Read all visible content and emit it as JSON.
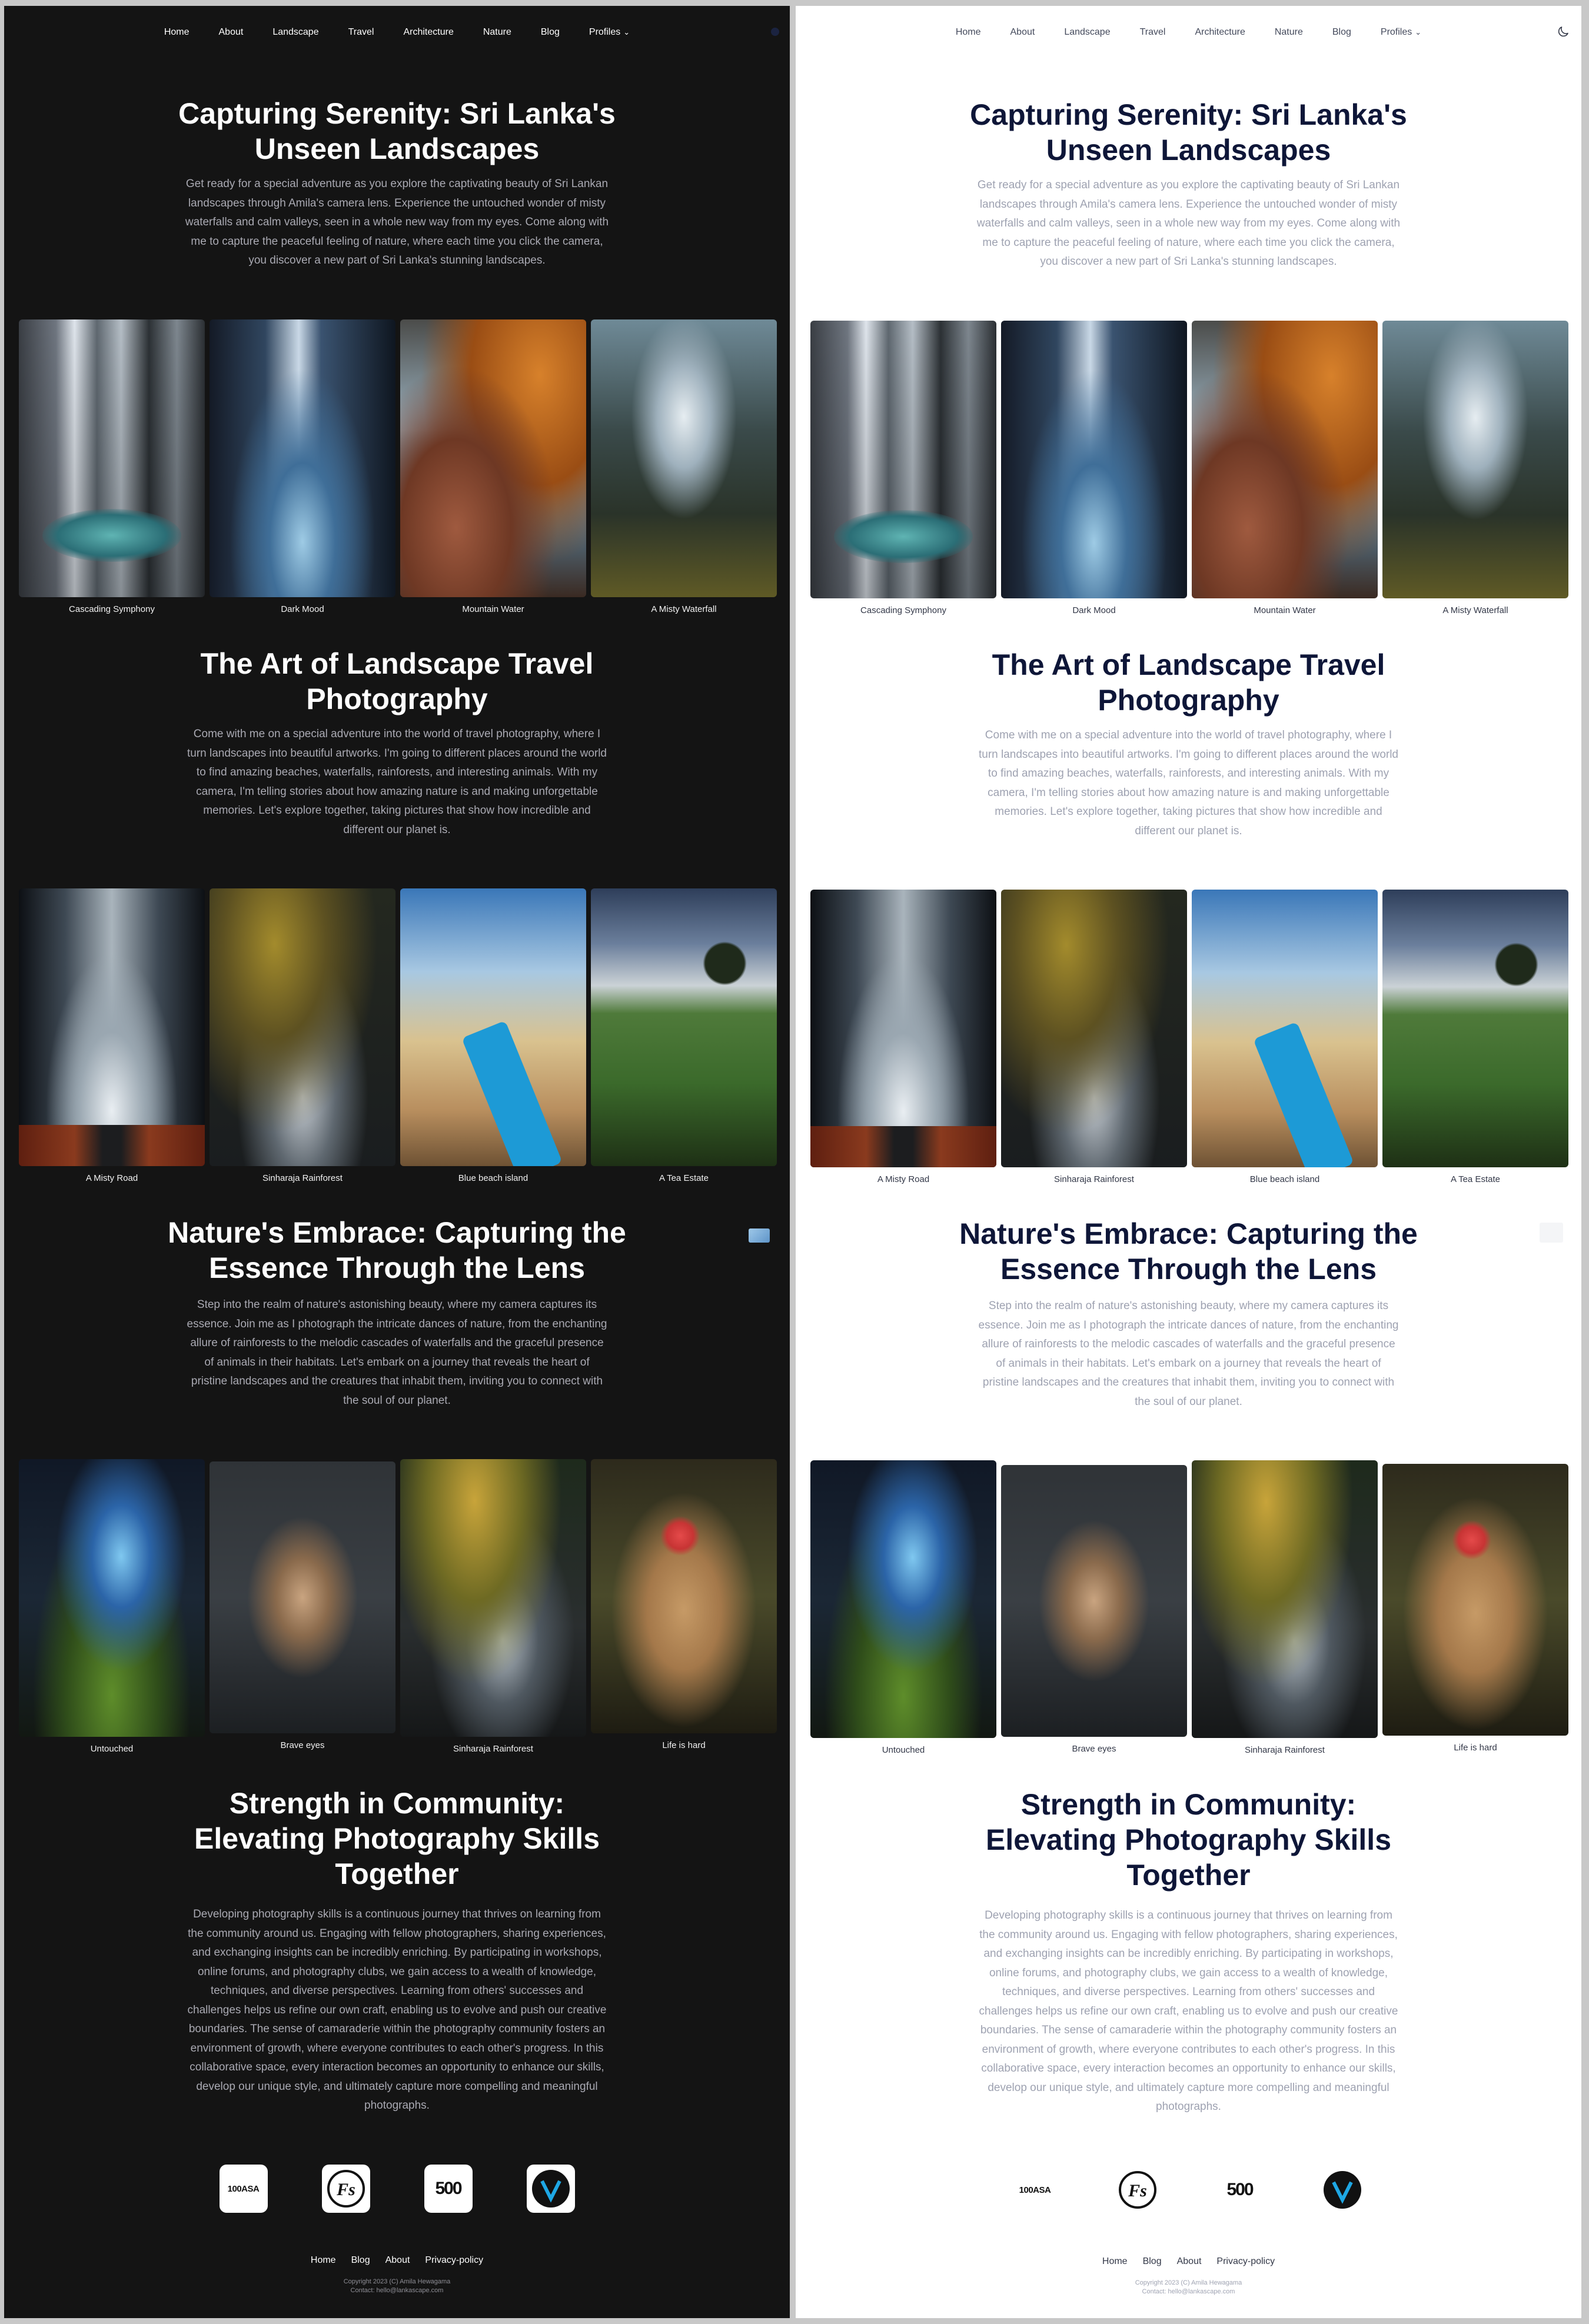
{
  "nav": {
    "items": [
      "Home",
      "About",
      "Landscape",
      "Travel",
      "Architecture",
      "Nature",
      "Blog",
      "Profiles"
    ]
  },
  "sections": [
    {
      "title": "Capturing Serenity: Sri Lanka's Unseen Landscapes",
      "text": "Get ready for a special adventure as you explore the captivating beauty of Sri Lankan landscapes through Amila's camera lens. Experience the untouched wonder of misty waterfalls and calm valleys, seen in a whole new way from my eyes. Come along with me to capture the peaceful feeling of nature, where each time you click the camera, you discover a new part of Sri Lanka's stunning landscapes.",
      "photos": [
        "Cascading Symphony",
        "Dark Mood",
        "Mountain Water",
        "A Misty Waterfall"
      ]
    },
    {
      "title": "The Art of Landscape Travel Photography",
      "text": "Come with me on a special adventure into the world of travel photography, where I turn landscapes into beautiful artworks. I'm going to different places around the world to find amazing beaches, waterfalls, rainforests, and interesting animals. With my camera, I'm telling stories about how amazing nature is and making unforgettable memories. Let's explore together, taking pictures that show how incredible and different our planet is.",
      "photos": [
        "A Misty Road",
        "Sinharaja Rainforest",
        "Blue beach island",
        "A Tea Estate"
      ]
    },
    {
      "title": "Nature's Embrace: Capturing the Essence Through the Lens",
      "text": "Step into the realm of nature's astonishing beauty, where my camera captures its essence. Join me as I photograph the intricate dances of nature, from the enchanting allure of rainforests to the melodic cascades of waterfalls and the graceful presence of animals in their habitats. Let's embark on a journey that reveals the heart of pristine landscapes and the creatures that inhabit them, inviting you to connect with the soul of our planet.",
      "photos": [
        "Untouched",
        "Brave eyes",
        "Sinharaja Rainforest",
        "Life is hard"
      ]
    },
    {
      "title": "Strength in Community: Elevating Photography Skills Together",
      "text": "Developing photography skills is a continuous journey that thrives on learning from the community around us. Engaging with fellow photographers, sharing experiences, and exchanging insights can be incredibly enriching. By participating in workshops, online forums, and photography clubs, we gain access to a wealth of knowledge, techniques, and diverse perspectives. Learning from others' successes and challenges helps us refine our own craft, enabling us to evolve and push our creative boundaries. The sense of camaraderie within the photography community fosters an environment of growth, where everyone contributes to each other's progress. In this collaborative space, every interaction becomes an opportunity to enhance our skills, develop our unique style, and ultimately capture more compelling and meaningful photographs."
    }
  ],
  "logos": {
    "logo_100asa": "100ASA",
    "logo_fs": "FS",
    "logo_500px": "500",
    "logo_vero": "V"
  },
  "footer": {
    "links": [
      "Home",
      "Blog",
      "About",
      "Privacy-policy"
    ],
    "copyright": "Copyright 2023 (C) Amila Hewagama",
    "contact": "Contact: hello@lankascape.com"
  },
  "themes": {
    "dark_bg": "#141414",
    "light_bg": "#ffffff",
    "light_title": "#0e1638"
  }
}
